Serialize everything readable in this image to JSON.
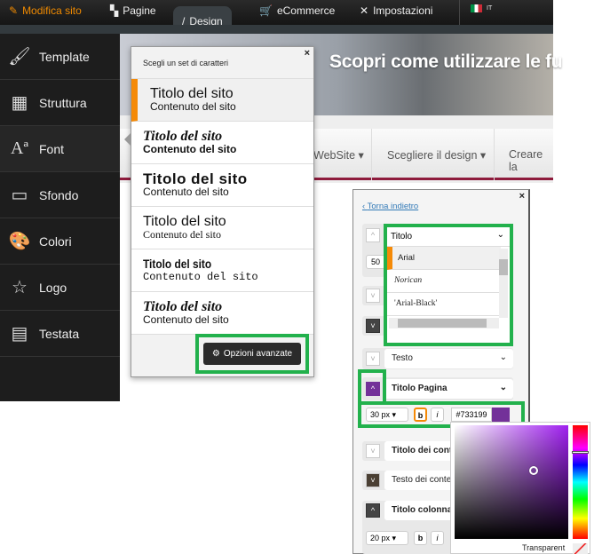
{
  "topbar": {
    "tabs": [
      {
        "label": "Modifica sito",
        "icon": "pencil-icon"
      },
      {
        "label": "Pagine",
        "icon": "pages-icon"
      },
      {
        "label": "Design",
        "icon": "brush-icon"
      },
      {
        "label": "eCommerce",
        "icon": "cart-icon"
      },
      {
        "label": "Impostazioni",
        "icon": "tools-icon"
      }
    ],
    "language": "IT"
  },
  "sidebar": {
    "items": [
      {
        "label": "Template",
        "icon": "brush-icon"
      },
      {
        "label": "Struttura",
        "icon": "layout-icon"
      },
      {
        "label": "Font",
        "icon": "font-icon"
      },
      {
        "label": "Sfondo",
        "icon": "monitor-icon"
      },
      {
        "label": "Colori",
        "icon": "palette-icon"
      },
      {
        "label": "Logo",
        "icon": "star-icon"
      },
      {
        "label": "Testata",
        "icon": "header-icon"
      }
    ]
  },
  "preview": {
    "banner_text": "Scopri come utilizzare le fu",
    "nav": [
      "WebSite",
      "Scegliere il design",
      "Creare la"
    ]
  },
  "font_popup": {
    "title": "Scegli un set di caratteri",
    "items": [
      {
        "title": "Titolo del sito",
        "content": "Contenuto del sito"
      },
      {
        "title": "Titolo del sito",
        "content": "Contenuto del sito"
      },
      {
        "title": "Titolo del sito",
        "content": "Contenuto del sito"
      },
      {
        "title": "Titolo del sito",
        "content": "Contenuto del sito"
      },
      {
        "title": "Titolo del sito",
        "content": "Contenuto del sito"
      },
      {
        "title": "Titolo del sito",
        "content": "Contenuto del sito"
      }
    ],
    "advanced_button": "Opzioni avanzate"
  },
  "advanced_panel": {
    "back": "Torna indietro",
    "titolo_select": "Titolo",
    "font_options": [
      "Arial",
      "Norican",
      "'Arial-Black'"
    ],
    "size_partial": "50",
    "testo": "Testo",
    "titolo_pagina": "Titolo Pagina",
    "size": "30 px",
    "bold": "b",
    "italic": "i",
    "color_hex": "#733199",
    "titolo_contenuti": "Titolo dei contenu",
    "testo_contenuti": "Testo dei conten",
    "titolo_colonna": "Titolo colonna lat",
    "size2": "20 px"
  },
  "color_picker": {
    "transparent": "Transparent",
    "selected": "#733199"
  },
  "colors": {
    "accent": "#f58a07",
    "highlight": "#22b14c",
    "purple": "#733199"
  }
}
